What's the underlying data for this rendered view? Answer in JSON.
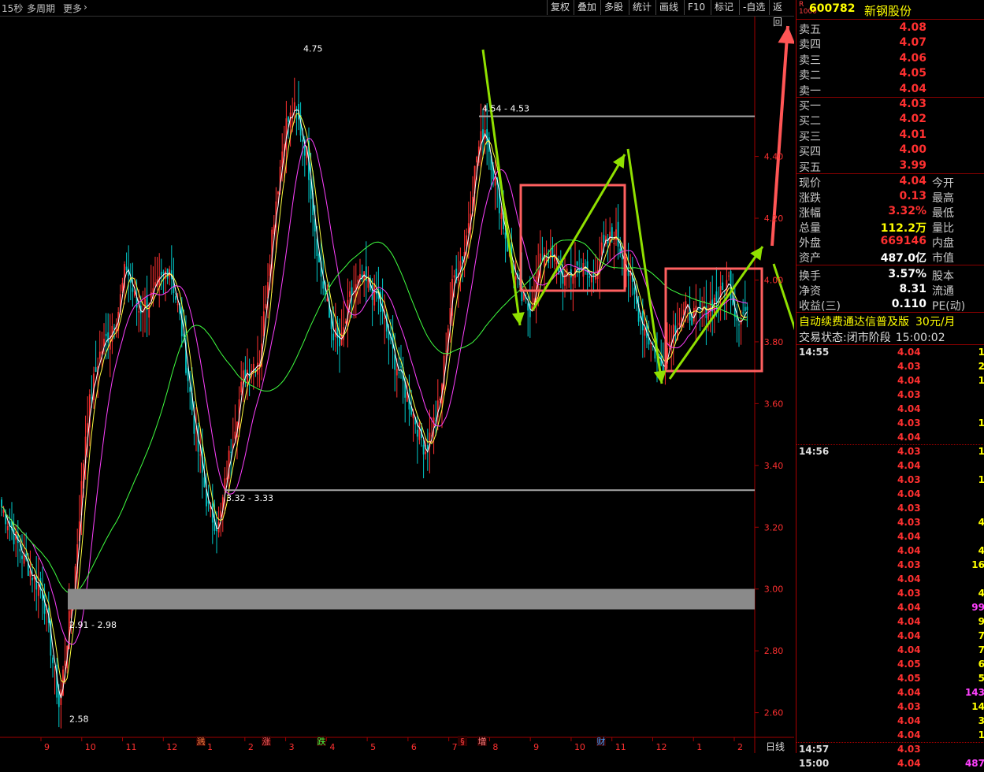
{
  "toolbar": {
    "period": "15秒",
    "multi_period": "多周期",
    "more": "更多",
    "buttons": [
      "复权",
      "叠加",
      "多股",
      "统计",
      "画线",
      "F10",
      "标记",
      "-自选",
      "返回"
    ]
  },
  "stock": {
    "code": "600782",
    "name": "新钢股份",
    "badge_r": "R",
    "badge_n": "1000"
  },
  "orderbook": {
    "asks": [
      {
        "label": "卖五",
        "price": "4.08"
      },
      {
        "label": "卖四",
        "price": "4.07"
      },
      {
        "label": "卖三",
        "price": "4.06"
      },
      {
        "label": "卖二",
        "price": "4.05"
      },
      {
        "label": "卖一",
        "price": "4.04"
      }
    ],
    "bids": [
      {
        "label": "买一",
        "price": "4.03"
      },
      {
        "label": "买二",
        "price": "4.02"
      },
      {
        "label": "买三",
        "price": "4.01"
      },
      {
        "label": "买四",
        "price": "4.00"
      },
      {
        "label": "买五",
        "price": "3.99"
      }
    ]
  },
  "quote": [
    {
      "label": "现价",
      "value": "4.04",
      "label2": "今开"
    },
    {
      "label": "涨跌",
      "value": "0.13",
      "label2": "最高"
    },
    {
      "label": "涨幅",
      "value": "3.32%",
      "label2": "最低"
    },
    {
      "label": "总量",
      "value": "112.2万",
      "label2": "量比"
    },
    {
      "label": "外盘",
      "value": "669146",
      "label2": "内盘"
    },
    {
      "label": "资产",
      "value": "487.0亿",
      "label2": "市值"
    },
    {
      "label": "换手",
      "value": "3.57%",
      "label2": "股本"
    },
    {
      "label": "净资",
      "value": "8.31",
      "label2": "流通"
    },
    {
      "label": "收益(三)",
      "value": "0.110",
      "label2": "PE(动)"
    }
  ],
  "promo": {
    "text": "自动续费通达信普及版",
    "price": "30元/月"
  },
  "trade_status": {
    "label": "交易状态:",
    "value": "闭市阶段",
    "time": "15:00:02"
  },
  "ticks": [
    {
      "time": "14:55",
      "price": "4.04",
      "vol": "1"
    },
    {
      "time": "",
      "price": "4.03",
      "vol": "2"
    },
    {
      "time": "",
      "price": "4.04",
      "vol": "1"
    },
    {
      "time": "",
      "price": "4.03",
      "vol": ""
    },
    {
      "time": "",
      "price": "4.04",
      "vol": ""
    },
    {
      "time": "",
      "price": "4.03",
      "vol": "1"
    },
    {
      "time": "",
      "price": "4.04",
      "vol": ""
    },
    {
      "time": "14:56",
      "price": "4.03",
      "vol": "1"
    },
    {
      "time": "",
      "price": "4.04",
      "vol": ""
    },
    {
      "time": "",
      "price": "4.03",
      "vol": "1"
    },
    {
      "time": "",
      "price": "4.04",
      "vol": ""
    },
    {
      "time": "",
      "price": "4.03",
      "vol": ""
    },
    {
      "time": "",
      "price": "4.03",
      "vol": "4"
    },
    {
      "time": "",
      "price": "4.04",
      "vol": ""
    },
    {
      "time": "",
      "price": "4.04",
      "vol": "4"
    },
    {
      "time": "",
      "price": "4.03",
      "vol": "16"
    },
    {
      "time": "",
      "price": "4.04",
      "vol": ""
    },
    {
      "time": "",
      "price": "4.03",
      "vol": "4"
    },
    {
      "time": "",
      "price": "4.04",
      "vol": "99"
    },
    {
      "time": "",
      "price": "4.04",
      "vol": "9"
    },
    {
      "time": "",
      "price": "4.04",
      "vol": "7"
    },
    {
      "time": "",
      "price": "4.04",
      "vol": "7"
    },
    {
      "time": "",
      "price": "4.05",
      "vol": "6"
    },
    {
      "time": "",
      "price": "4.05",
      "vol": "5"
    },
    {
      "time": "",
      "price": "4.04",
      "vol": "143"
    },
    {
      "time": "",
      "price": "4.03",
      "vol": "14"
    },
    {
      "time": "",
      "price": "4.04",
      "vol": "3"
    },
    {
      "time": "",
      "price": "4.04",
      "vol": "1"
    },
    {
      "time": "14:57",
      "price": "4.03",
      "vol": ""
    },
    {
      "time": "15:00",
      "price": "4.04",
      "vol": "487"
    }
  ],
  "colors": {
    "up": "#ff3030",
    "down": "#00c8c8",
    "flat": "#ffffff",
    "ma5": "#ffffff",
    "ma10": "#ffff40",
    "ma20": "#ff40ff",
    "ma60": "#40ff40",
    "accent": "#ffff00"
  },
  "chart_data": {
    "type": "candlestick",
    "y_ticks": [
      "4.40",
      "4.20",
      "4.00",
      "3.80",
      "3.60",
      "3.40",
      "3.20",
      "3.00",
      "2.80",
      "2.60"
    ],
    "ylim": [
      2.52,
      4.84
    ],
    "x_ticks": [
      "9",
      "10",
      "11",
      "12",
      "1",
      "2",
      "3",
      "4",
      "5",
      "6",
      "7",
      "8",
      "9",
      "10",
      "11",
      "12",
      "1",
      "2"
    ],
    "period_label": "日线",
    "annotations": [
      {
        "text": "4.75",
        "price": 4.75
      },
      {
        "text": "4.54 - 4.53",
        "price": 4.53
      },
      {
        "text": "3.32 - 3.33",
        "price": 3.32
      },
      {
        "text": "2.91 - 2.98",
        "price": 2.91
      },
      {
        "text": "2.58",
        "price": 2.58
      }
    ],
    "levels": [
      4.53,
      3.32
    ],
    "band": [
      2.91,
      2.98
    ],
    "event_markers": [
      "溅",
      "涨",
      "跌",
      "§",
      "增",
      "财"
    ],
    "anchors": [
      [
        0,
        3.28
      ],
      [
        30,
        3.1
      ],
      [
        55,
        2.98
      ],
      [
        75,
        2.62
      ],
      [
        95,
        3.05
      ],
      [
        110,
        3.55
      ],
      [
        125,
        3.75
      ],
      [
        150,
        3.9
      ],
      [
        160,
        4.05
      ],
      [
        175,
        3.9
      ],
      [
        195,
        3.95
      ],
      [
        215,
        4.05
      ],
      [
        230,
        3.85
      ],
      [
        248,
        3.5
      ],
      [
        265,
        3.25
      ],
      [
        278,
        3.2
      ],
      [
        292,
        3.45
      ],
      [
        310,
        3.7
      ],
      [
        330,
        3.75
      ],
      [
        345,
        4.15
      ],
      [
        362,
        4.5
      ],
      [
        375,
        4.55
      ],
      [
        390,
        4.4
      ],
      [
        405,
        4.05
      ],
      [
        420,
        3.85
      ],
      [
        432,
        3.78
      ],
      [
        445,
        3.95
      ],
      [
        460,
        4.0
      ],
      [
        478,
        3.95
      ],
      [
        500,
        3.75
      ],
      [
        520,
        3.6
      ],
      [
        540,
        3.45
      ],
      [
        558,
        3.6
      ],
      [
        575,
        4.0
      ],
      [
        590,
        4.1
      ],
      [
        605,
        4.4
      ],
      [
        615,
        4.5
      ],
      [
        630,
        4.3
      ],
      [
        645,
        4.1
      ],
      [
        660,
        3.95
      ],
      [
        672,
        3.9
      ],
      [
        690,
        4.1
      ],
      [
        705,
        4.05
      ],
      [
        718,
        4.0
      ],
      [
        735,
        4.05
      ],
      [
        750,
        4.0
      ],
      [
        765,
        4.1
      ],
      [
        780,
        4.15
      ],
      [
        795,
        4.05
      ],
      [
        810,
        3.9
      ],
      [
        825,
        3.8
      ],
      [
        840,
        3.72
      ],
      [
        855,
        3.85
      ],
      [
        870,
        3.9
      ],
      [
        885,
        3.88
      ],
      [
        900,
        3.92
      ],
      [
        915,
        3.95
      ],
      [
        925,
        4.0
      ],
      [
        935,
        3.88
      ],
      [
        948,
        3.9
      ]
    ]
  }
}
